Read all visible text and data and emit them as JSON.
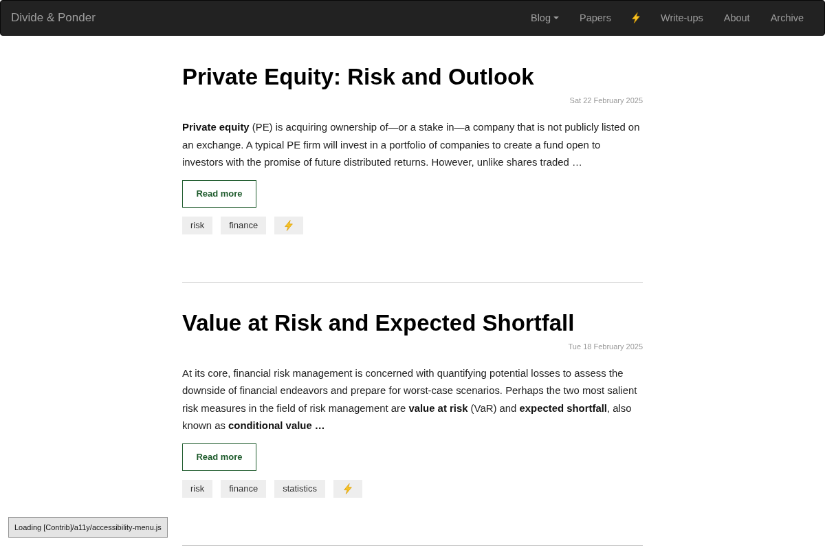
{
  "navbar": {
    "brand": "Divide & Ponder",
    "items": [
      {
        "kind": "text",
        "label": "Blog",
        "dropdown": true
      },
      {
        "kind": "text",
        "label": "Papers",
        "dropdown": false
      },
      {
        "kind": "icon"
      },
      {
        "kind": "text",
        "label": "Write-ups",
        "dropdown": false
      },
      {
        "kind": "text",
        "label": "About",
        "dropdown": false
      },
      {
        "kind": "text",
        "label": "Archive",
        "dropdown": false
      }
    ]
  },
  "posts": [
    {
      "title": "Private Equity: Risk and Outlook",
      "date": "Sat 22 February 2025",
      "excerpt": "**Private equity** (PE) is acquiring ownership of—or a stake in—a company that is not publicly listed on an exchange. A typical PE firm will invest in a portfolio of companies to create a fund open to investors with the promise of future distributed returns. However, unlike shares traded …",
      "button": "Read more",
      "tags": [
        {
          "kind": "text",
          "label": "risk"
        },
        {
          "kind": "text",
          "label": "finance"
        },
        {
          "kind": "icon"
        }
      ]
    },
    {
      "title": "Value at Risk and Expected Shortfall",
      "date": "Tue 18 February 2025",
      "excerpt": "At its core, financial risk management is concerned with quantifying potential losses to assess the downside of financial endeavors and prepare for worst-case scenarios. Perhaps the two most salient risk measures in the field of risk management are **value at risk** (VaR) and **expected shortfall**, also known as **conditional value …**",
      "button": "Read more",
      "tags": [
        {
          "kind": "text",
          "label": "risk"
        },
        {
          "kind": "text",
          "label": "finance"
        },
        {
          "kind": "text",
          "label": "statistics"
        },
        {
          "kind": "icon"
        }
      ]
    }
  ],
  "status_message": "Loading [Contrib]/a11y/accessibility-menu.js"
}
